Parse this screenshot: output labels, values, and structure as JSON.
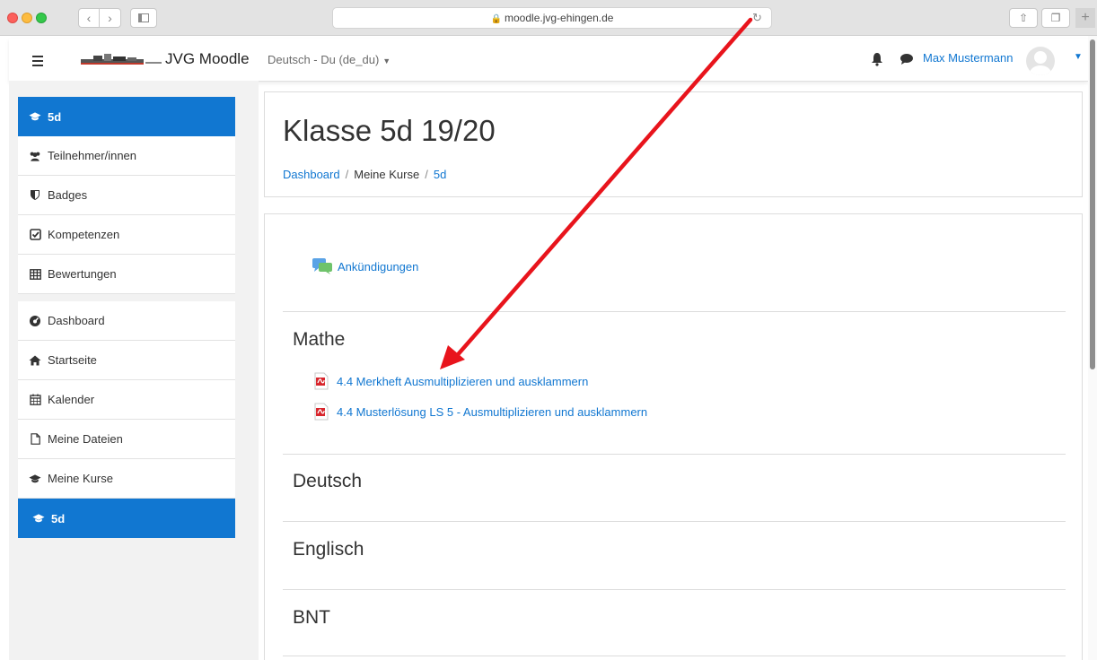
{
  "browser": {
    "url": "moodle.jvg-ehingen.de"
  },
  "navbar": {
    "site_name": "JVG Moodle",
    "language": "Deutsch - Du (de_du)",
    "user_name": "Max Mustermann"
  },
  "drawer": {
    "course_items": [
      {
        "label": "5d",
        "icon": "graduation-cap-icon"
      },
      {
        "label": "Teilnehmer/innen",
        "icon": "users-icon"
      },
      {
        "label": "Badges",
        "icon": "shield-icon"
      },
      {
        "label": "Kompetenzen",
        "icon": "check-square-icon"
      },
      {
        "label": "Bewertungen",
        "icon": "table-icon"
      }
    ],
    "site_items": [
      {
        "label": "Dashboard",
        "icon": "dashboard-icon"
      },
      {
        "label": "Startseite",
        "icon": "home-icon"
      },
      {
        "label": "Kalender",
        "icon": "calendar-icon"
      },
      {
        "label": "Meine Dateien",
        "icon": "file-icon"
      },
      {
        "label": "Meine Kurse",
        "icon": "graduation-cap-icon"
      },
      {
        "label": "5d",
        "icon": "graduation-cap-icon"
      }
    ]
  },
  "header": {
    "title": "Klasse 5d 19/20",
    "breadcrumb": [
      "Dashboard",
      "Meine Kurse",
      "5d"
    ]
  },
  "course": {
    "announcements": "Ankündigungen",
    "sections": [
      {
        "title": "Mathe",
        "activities": [
          "4.4 Merkheft Ausmultiplizieren und ausklammern",
          "4.4 Musterlösung LS 5 - Ausmultiplizieren und ausklammern"
        ]
      },
      {
        "title": "Deutsch",
        "activities": []
      },
      {
        "title": "Englisch",
        "activities": []
      },
      {
        "title": "BNT",
        "activities": []
      }
    ]
  },
  "colors": {
    "accent": "#1177d1",
    "annotation_arrow": "#e8141c"
  }
}
